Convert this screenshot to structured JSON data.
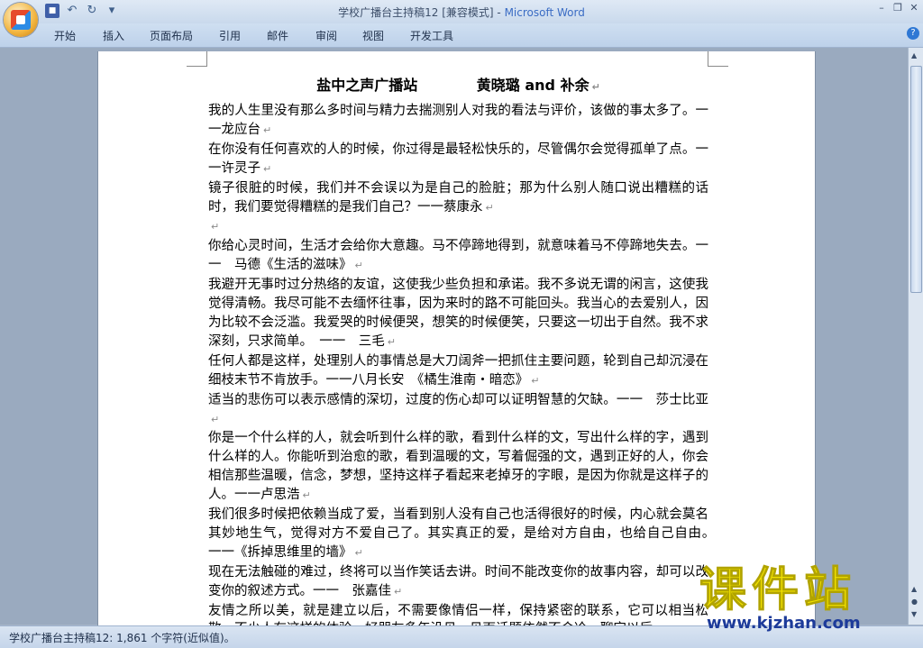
{
  "window": {
    "doc_title": "学校广播台主持稿12 [兼容模式]",
    "separator": " - ",
    "app_name": "Microsoft Word"
  },
  "ribbon": {
    "tabs": [
      "开始",
      "插入",
      "页面布局",
      "引用",
      "邮件",
      "审阅",
      "视图",
      "开发工具"
    ]
  },
  "document": {
    "heading_left": "盐中之声广播站",
    "heading_right": "黄晓璐 and 补余",
    "paragraphs": [
      "我的人生里没有那么多时间与精力去揣测别人对我的看法与评价，该做的事太多了。一一龙应台",
      "在你没有任何喜欢的人的时候，你过得是最轻松快乐的，尽管偶尔会觉得孤单了点。一一许灵子",
      "镜子很脏的时候，我们并不会误以为是自己的脸脏；那为什么别人随口说出糟糕的话时，我们要觉得糟糕的是我们自己？一一蔡康永",
      "",
      "你给心灵时间，生活才会给你大意趣。马不停蹄地得到，就意味着马不停蹄地失去。一一　马德《生活的滋味》",
      "我避开无事时过分热络的友谊，这使我少些负担和承诺。我不多说无谓的闲言，这使我觉得清畅。我尽可能不去缅怀往事，因为来时的路不可能回头。我当心的去爱别人，因为比较不会泛滥。我爱哭的时候便哭，想笑的时候便笑，只要这一切出于自然。我不求深刻，只求简单。　一一　三毛",
      "任何人都是这样，处理别人的事情总是大刀阔斧一把抓住主要问题，轮到自己却沉浸在细枝末节不肯放手。一一八月长安　《橘生淮南・暗恋》",
      "适当的悲伤可以表示感情的深切，过度的伤心却可以证明智慧的欠缺。一一　莎士比亚",
      "你是一个什么样的人，就会听到什么样的歌，看到什么样的文，写出什么样的字，遇到什么样的人。你能听到治愈的歌，看到温暖的文，写着倔强的文，遇到正好的人，你会相信那些温暖，信念，梦想，坚持这样子看起来老掉牙的字眼，是因为你就是这样子的人。一一卢思浩",
      "我们很多时候把依赖当成了爱，当看到别人没有自己也活得很好的时候，内心就会莫名其妙地生气，觉得对方不爱自己了。其实真正的爱，是给对方自由，也给自己自由。　一一《拆掉思维里的墙》",
      "现在无法触碰的难过，终将可以当作笑话去讲。时间不能改变你的故事内容，却可以改变你的叙述方式。一一　张嘉佳",
      "友情之所以美，就是建立以后，不需要像情侣一样，保持紧密的联系，它可以相当松散，不少人有这样的体验，好朋友多年没见，见面话题依然不会冷，聊完以后"
    ],
    "para_mark": "↵"
  },
  "status": {
    "text": "学校广播台主持稿12: 1,861 个字符(近似值)。"
  },
  "watermark": {
    "title": "课件站",
    "url": "www.kjzhan.com"
  },
  "colors": {
    "app_title": "#3a6cc4",
    "watermark_yellow": "#f2e200",
    "watermark_blue": "#1d3b9a"
  }
}
